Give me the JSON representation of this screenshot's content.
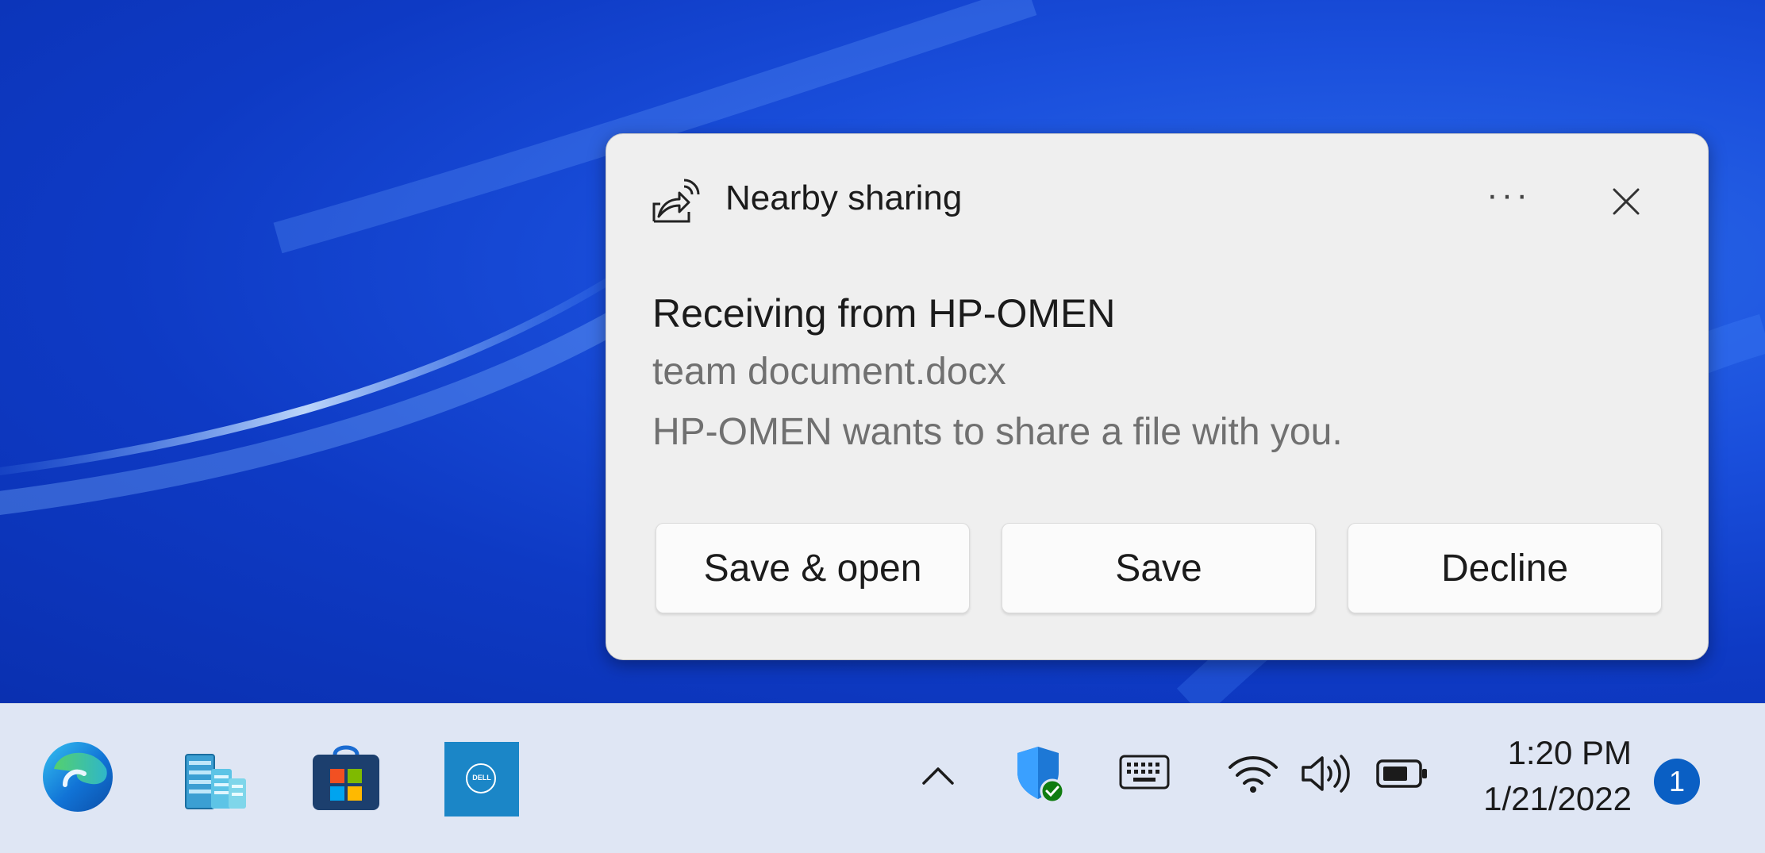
{
  "notification": {
    "app_name": "Nearby sharing",
    "more_label": "···",
    "title": "Receiving from HP-OMEN",
    "file_name": "team document.docx",
    "body": "HP-OMEN wants to share a file with you.",
    "buttons": {
      "save_open": "Save & open",
      "save": "Save",
      "decline": "Decline"
    }
  },
  "taskbar": {
    "apps": [
      "edge-icon",
      "server-manager-icon",
      "microsoft-store-icon",
      "dell-icon"
    ],
    "dell_label": "DELL",
    "tray_icons": [
      "chevron-up-icon",
      "windows-security-icon",
      "touch-keyboard-icon",
      "wifi-icon",
      "volume-icon",
      "battery-icon"
    ],
    "clock": {
      "time": "1:20 PM",
      "date": "1/21/2022"
    },
    "notification_count": "1"
  },
  "colors": {
    "desktop": "#1a4fdc",
    "toast_bg": "#efefef",
    "taskbar_bg": "#dfe6f4",
    "badge": "#0a5fc4"
  }
}
